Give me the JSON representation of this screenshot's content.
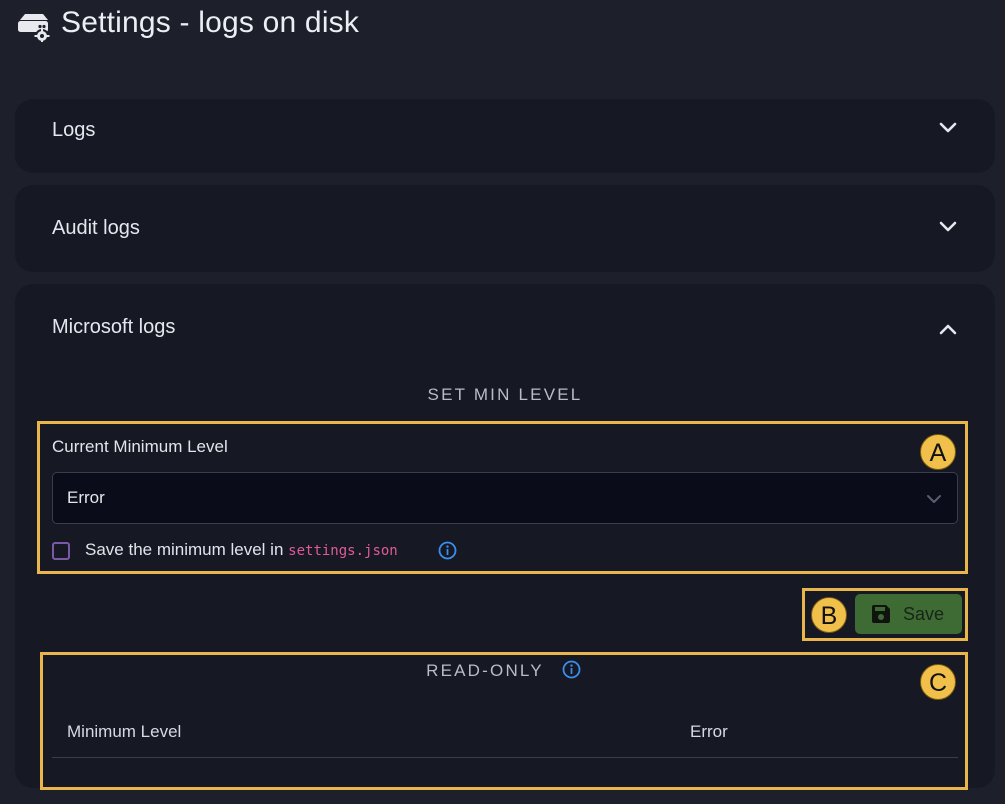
{
  "header": {
    "title": "Settings - logs on disk",
    "icon": "server-settings-icon"
  },
  "panels": [
    {
      "title": "Logs",
      "expanded": false
    },
    {
      "title": "Audit logs",
      "expanded": false
    },
    {
      "title": "Microsoft logs",
      "expanded": true
    }
  ],
  "microsoft_logs": {
    "set_min_level": {
      "heading": "SET MIN LEVEL",
      "field_label": "Current Minimum Level",
      "selected_value": "Error",
      "checkbox_label": "Save the minimum level in",
      "checkbox_code": "settings.json",
      "checkbox_checked": false
    },
    "save_button": {
      "label": "Save",
      "icon": "floppy-disk-icon",
      "color": "#3e6a34"
    },
    "read_only": {
      "heading": "READ-ONLY",
      "rows": [
        {
          "label": "Minimum Level",
          "value": "Error"
        }
      ]
    }
  },
  "annotations": {
    "a": "A",
    "b": "B",
    "c": "C",
    "color": "#e8b64a"
  }
}
